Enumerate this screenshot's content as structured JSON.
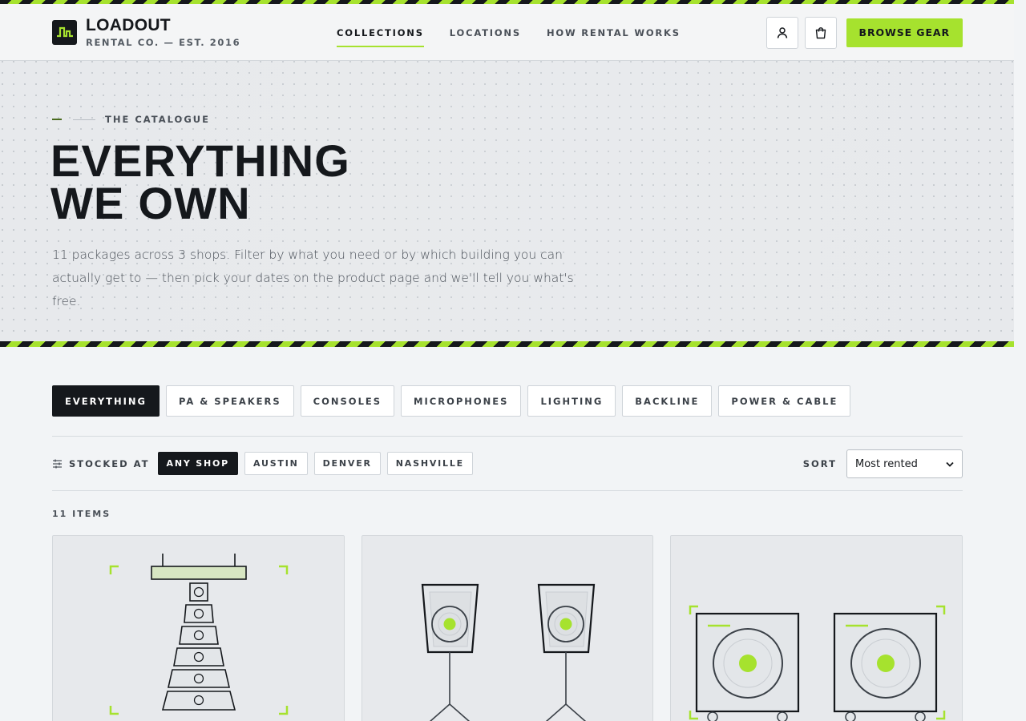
{
  "header": {
    "brand_name": "LOADOUT",
    "brand_sub": "RENTAL CO. — EST. 2016",
    "nav": [
      {
        "label": "COLLECTIONS",
        "active": true
      },
      {
        "label": "LOCATIONS",
        "active": false
      },
      {
        "label": "HOW RENTAL WORKS",
        "active": false
      }
    ],
    "account_icon": "user-icon",
    "cart_icon": "shopping-bag-icon",
    "cta_label": "BROWSE GEAR"
  },
  "hero": {
    "eyebrow": "THE CATALOGUE",
    "title_line1": "EVERYTHING",
    "title_line2": "WE OWN",
    "description": "11 packages across 3 shops. Filter by what you need or by which building you can actually get to — then pick your dates on the product page and we'll tell you what's free."
  },
  "categories": [
    {
      "label": "EVERYTHING",
      "active": true
    },
    {
      "label": "PA & SPEAKERS",
      "active": false
    },
    {
      "label": "CONSOLES",
      "active": false
    },
    {
      "label": "MICROPHONES",
      "active": false
    },
    {
      "label": "LIGHTING",
      "active": false
    },
    {
      "label": "BACKLINE",
      "active": false
    },
    {
      "label": "POWER & CABLE",
      "active": false
    }
  ],
  "filters": {
    "icon": "sliders-icon",
    "label": "STOCKED AT",
    "shops": [
      {
        "label": "ANY SHOP",
        "active": true
      },
      {
        "label": "AUSTIN",
        "active": false
      },
      {
        "label": "DENVER",
        "active": false
      },
      {
        "label": "NASHVILLE",
        "active": false
      }
    ],
    "sort_label": "SORT",
    "sort_value": "Most rented"
  },
  "results": {
    "count_label": "11 ITEMS"
  },
  "products": [
    {
      "illustration": "line-array-icon"
    },
    {
      "illustration": "speakers-on-stands-icon"
    },
    {
      "illustration": "subwoofers-icon"
    }
  ],
  "colors": {
    "accent": "#a6e22e",
    "ink": "#15181c",
    "background": "#f2f4f6"
  }
}
